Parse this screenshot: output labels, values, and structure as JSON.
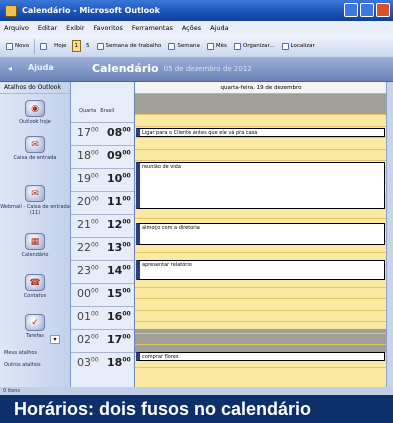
{
  "window": {
    "title": "Calendário - Microsoft Outlook"
  },
  "menu": [
    "Arquivo",
    "Editar",
    "Exibir",
    "Favoritos",
    "Ferramentas",
    "Ações",
    "Ajuda"
  ],
  "toolbar": {
    "new": "Novo",
    "today": "Hoje",
    "day": "1",
    "workweek": "5",
    "view_week": "Semana de trabalho",
    "view_7": "Semana",
    "month": "Mês",
    "organizer": "Organizar...",
    "find": "Localizar"
  },
  "panes": {
    "left_title": "Ajuda",
    "calendar_title": "Calendário",
    "date_range": "05 de dezembro de 2012"
  },
  "sidebar": {
    "header": "Atalhos do Outlook",
    "items": [
      {
        "label": "Outlook hoje",
        "icon": "outlook-today-icon"
      },
      {
        "label": "Caixa de entrada",
        "icon": "inbox-icon"
      },
      {
        "label": "Webmail - Caixa de entrada (11)",
        "icon": "webmail-icon"
      },
      {
        "label": "Calendário",
        "icon": "calendar-icon"
      },
      {
        "label": "Contatos",
        "icon": "contacts-icon"
      },
      {
        "label": "Tarefas",
        "icon": "tasks-icon"
      }
    ],
    "link_shortcuts": "Meus atalhos",
    "link_others": "Outros atalhos"
  },
  "timezones": {
    "tz1_label": "Quarta",
    "tz2_label": "Brasil"
  },
  "times": [
    {
      "a": "17",
      "b": "08"
    },
    {
      "a": "18",
      "b": "09"
    },
    {
      "a": "19",
      "b": "10"
    },
    {
      "a": "20",
      "b": "11"
    },
    {
      "a": "21",
      "b": "12"
    },
    {
      "a": "22",
      "b": "13"
    },
    {
      "a": "23",
      "b": "14"
    },
    {
      "a": "00",
      "b": "15"
    },
    {
      "a": "01",
      "b": "16"
    },
    {
      "a": "02",
      "b": "17"
    },
    {
      "a": "03",
      "b": "18"
    }
  ],
  "minutes": "00",
  "day_header": "quarta-feira, 19 de dezembro",
  "appointments": [
    "Ligar para o Cliente antes que ele vá pra casa",
    "reunião de vida",
    "almoço com a diretoria",
    "apresentar relatório",
    "comprar flores"
  ],
  "status": "0 itens",
  "caption": "Horários: dois fusos no calendário"
}
